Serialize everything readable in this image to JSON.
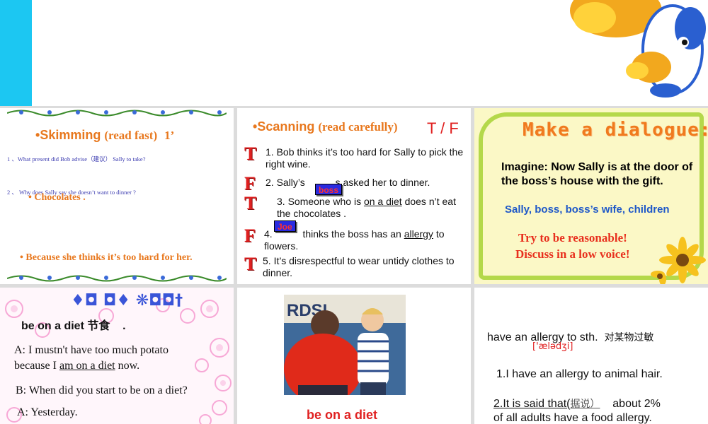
{
  "colors": {
    "accent_blue": "#1cc7f2",
    "orange": "#e8781e",
    "red": "#e02020",
    "green_frame": "#b4d84a"
  },
  "slide1": {
    "title": "Skimming",
    "title_sub": "(read fast)",
    "title_num": "1’",
    "q1": "1 、What present did Bob advise（建议） Sally to take?",
    "q2": "2 、 Why does Sally say she doesn’t want to dinner ?",
    "a1": "Chocolates .",
    "a2": "Because she thinks it’s too hard for her."
  },
  "slide2": {
    "title": "Scanning",
    "title_sub": "(read carefully)",
    "tf_label": "T / F",
    "marks": [
      "T",
      "F",
      "T",
      "F",
      "T"
    ],
    "item1": "1. Bob thinks it’s too hard for Sally to pick the right wine.",
    "item2a": "2. Sally’s ",
    "item2b": "s asked her to dinner.",
    "item3a": "3. Someone  who is ",
    "item3_u": "on a diet",
    "item3b": " does n’t eat the chocolates .",
    "item4a": "4.",
    "item4b": "thinks the boss has an ",
    "item4_u": "allergy",
    "item4c": " to flowers.",
    "item5": "5. It’s disrespectful to wear untidy clothes to dinner.",
    "chip_boss": "boss",
    "chip_joe": "Joe"
  },
  "slide3": {
    "title": "Make a dialogue:",
    "text": "Imagine: Now Sally is at the door of the boss’s house with the gift.",
    "roles": "Sally, boss, boss’s wife, children",
    "line1": "Try to be reasonable!",
    "line2": "Discuss in a low voice!"
  },
  "slide4": {
    "heading": "♦◘ ◘♦ ❋◘◘†",
    "diet_en": "be on a diet",
    "diet_cn": "节食",
    "diet_dot": ".",
    "a1": "A: I mustn't have too much potato",
    "a2a": "because I ",
    "a2_u": "am on a diet",
    "a2b": " now.",
    "b1": "B: When did you start to be on a diet?",
    "a3": "A: Yesterday."
  },
  "slide5": {
    "photo_sign": "RDSL",
    "caption": "be on a diet"
  },
  "slide6": {
    "phrase": "have an allergy to sth.",
    "phrase_cn": "对某物过敏",
    "phonetic": "['ælədʒi]",
    "ex1": "1.I have an allergy to animal hair.",
    "ex2_u": "2.It is said that(",
    "ex2_cn": "据说）",
    "ex2b": "about 2%",
    "ex2c": "of all adults have a food allergy."
  }
}
